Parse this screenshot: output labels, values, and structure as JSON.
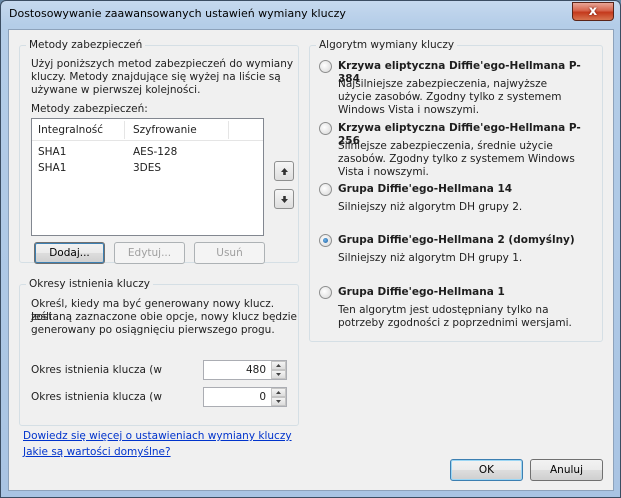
{
  "window": {
    "title": "Dostosowywanie zaawansowanych ustawień wymiany kluczy",
    "close": "x"
  },
  "security_methods": {
    "legend": "Metody zabezpieczeń",
    "description": [
      "Użyj poniższych metod zabezpieczeń do wymiany",
      "kluczy. Metody znajdujące się wyżej na liście są",
      "używane w pierwszej kolejności."
    ],
    "list_label": "Metody zabezpieczeń:",
    "columns": [
      "Integralność",
      "Szyfrowanie"
    ],
    "rows": [
      {
        "integrity": "SHA1",
        "encryption": "AES-128"
      },
      {
        "integrity": "SHA1",
        "encryption": "3DES"
      }
    ],
    "buttons": {
      "add": "Dodaj...",
      "edit": "Edytuj...",
      "remove": "Usuń"
    }
  },
  "key_lifetimes": {
    "legend": "Okresy istnienia kluczy",
    "description": [
      "Określ, kiedy ma być generowany nowy klucz. Jeśli",
      "zostaną zaznaczone obie opcje, nowy klucz będzie",
      "generowany po osiągnięciu pierwszego progu."
    ],
    "field1_label": "Okres istnienia klucza (w",
    "field1_value": "480",
    "field2_label": "Okres istnienia klucza (w",
    "field2_value": "0"
  },
  "algorithm": {
    "legend": "Algorytm wymiany kluczy",
    "options": [
      {
        "title": "Krzywa eliptyczna Diffie'ego-Hellmana P-384",
        "desc": [
          "Najsilniejsze zabezpieczenia, najwyższe",
          "użycie zasobów. Zgodny tylko z systemem",
          "Windows Vista i nowszymi."
        ],
        "checked": false
      },
      {
        "title": "Krzywa eliptyczna Diffie'ego-Hellmana P-256",
        "desc": [
          "Silniejsze zabezpieczenia, średnie użycie",
          "zasobów. Zgodny tylko z systemem Windows",
          "Vista i nowszymi."
        ],
        "checked": false
      },
      {
        "title": "Grupa Diffie'ego-Hellmana 14",
        "desc": [
          "Silniejszy niż algorytm DH grupy 2."
        ],
        "checked": false
      },
      {
        "title": "Grupa Diffie'ego-Hellmana 2 (domyślny)",
        "desc": [
          "Silniejszy niż algorytm DH grupy 1."
        ],
        "checked": true
      },
      {
        "title": "Grupa Diffie'ego-Hellmana 1",
        "desc": [
          "Ten algorytm jest udostępniany tylko na",
          "potrzeby zgodności z poprzednimi wersjami."
        ],
        "checked": false
      }
    ]
  },
  "links": {
    "learn_more": "Dowiedz się więcej o ustawieniach wymiany kluczy",
    "defaults": "Jakie są wartości domyślne?"
  },
  "footer": {
    "ok": "OK",
    "cancel": "Anuluj"
  },
  "icons": {
    "up": "arrow-up-icon",
    "down": "arrow-down-icon"
  }
}
